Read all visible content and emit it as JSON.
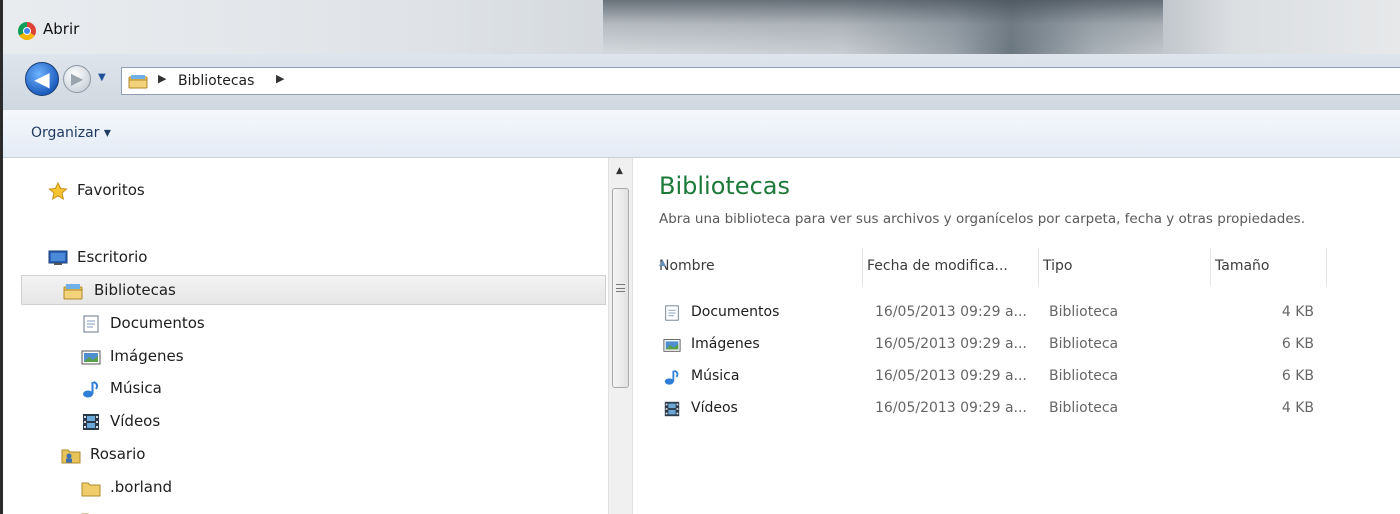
{
  "window": {
    "title": "Abrir"
  },
  "nav": {
    "back_label": "◀",
    "forward_label": "▶",
    "history_label": "▼",
    "breadcrumb": {
      "separator": "▶",
      "crumb": "Bibliotecas"
    }
  },
  "toolbar": {
    "organize_label": "Organizar ▾"
  },
  "sidebar": {
    "items": [
      {
        "label": "Favoritos",
        "icon": "star-icon"
      },
      {
        "label": "Escritorio",
        "icon": "desktop-icon"
      },
      {
        "label": "Bibliotecas",
        "icon": "libraries-icon",
        "selected": true
      },
      {
        "label": "Documentos",
        "icon": "documents-icon"
      },
      {
        "label": "Imágenes",
        "icon": "pictures-icon"
      },
      {
        "label": "Música",
        "icon": "music-icon"
      },
      {
        "label": "Vídeos",
        "icon": "videos-icon"
      },
      {
        "label": "Rosario",
        "icon": "user-folder-icon"
      },
      {
        "label": ".borland",
        "icon": "folder-icon"
      }
    ]
  },
  "scrollbar": {
    "up_arrow": "▲"
  },
  "main": {
    "title": "Bibliotecas",
    "subtitle": "Abra una biblioteca para ver sus archivos y organícelos por carpeta, fecha y otras propiedades.",
    "columns": {
      "name": "Nombre",
      "date": "Fecha de modifica...",
      "type": "Tipo",
      "size": "Tamaño",
      "sort_arrow": "▲"
    },
    "rows": [
      {
        "name": "Documentos",
        "date": "16/05/2013 09:29 a...",
        "type": "Biblioteca",
        "size": "4 KB",
        "icon": "documents-icon"
      },
      {
        "name": "Imágenes",
        "date": "16/05/2013 09:29 a...",
        "type": "Biblioteca",
        "size": "6 KB",
        "icon": "pictures-icon"
      },
      {
        "name": "Música",
        "date": "16/05/2013 09:29 a...",
        "type": "Biblioteca",
        "size": "6 KB",
        "icon": "music-icon"
      },
      {
        "name": "Vídeos",
        "date": "16/05/2013 09:29 a...",
        "type": "Biblioteca",
        "size": "4 KB",
        "icon": "videos-icon"
      }
    ]
  },
  "colors": {
    "title_green": "#1e7a3a",
    "selection": "#e6e6e6",
    "accent_blue": "#1e5fbf"
  }
}
